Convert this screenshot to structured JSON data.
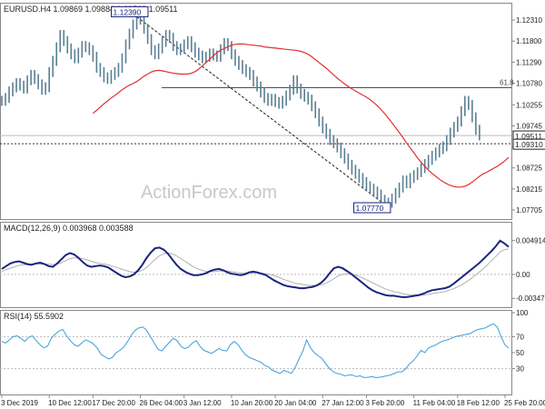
{
  "colors": {
    "price": "#5a7f93",
    "ma": "#e03030",
    "macd": "#1a237e",
    "macd_signal": "#b0b0b0",
    "rsi": "#3b9ddb",
    "level": "#555555",
    "grid_label": "#222222",
    "box_fill": "#ffffff",
    "box_stroke": "#1a237e",
    "box_text": "#1a237e",
    "watermark": "#c8c8c8"
  },
  "watermark": "ActionForex.com",
  "chart_data": [
    {
      "type": "line",
      "title": "EURUSD.H4  1.09869 1.09884 1.09509 1.09511",
      "ylim": [
        1.0755,
        1.1262
      ],
      "yticks": [
        "1.12310",
        "1.11800",
        "1.11290",
        "1.10780",
        "1.10255",
        "1.09745",
        "1.09235",
        "1.08725",
        "1.08215",
        "1.07705"
      ],
      "ytick_values": [
        1.1231,
        1.118,
        1.1129,
        1.1078,
        1.10255,
        1.09745,
        1.09235,
        1.08725,
        1.08215,
        1.07705
      ],
      "x_bars": 140,
      "close": [
        1.1035,
        1.1042,
        1.1058,
        1.1068,
        1.1078,
        1.1072,
        1.1065,
        1.1085,
        1.1098,
        1.1088,
        1.1075,
        1.1062,
        1.1068,
        1.1105,
        1.1132,
        1.1165,
        1.1195,
        1.118,
        1.1162,
        1.1148,
        1.1138,
        1.1152,
        1.1168,
        1.1165,
        1.1158,
        1.1142,
        1.1115,
        1.1105,
        1.1092,
        1.1088,
        1.1098,
        1.1105,
        1.1115,
        1.1138,
        1.1172,
        1.1198,
        1.122,
        1.1238,
        1.1232,
        1.121,
        1.1185,
        1.1158,
        1.1148,
        1.1162,
        1.1178,
        1.1195,
        1.1188,
        1.1168,
        1.1158,
        1.1162,
        1.1172,
        1.118,
        1.1165,
        1.1152,
        1.1145,
        1.1138,
        1.1142,
        1.115,
        1.1145,
        1.1142,
        1.116,
        1.1175,
        1.1168,
        1.1148,
        1.1132,
        1.1122,
        1.1112,
        1.1105,
        1.1098,
        1.1082,
        1.107,
        1.1055,
        1.1042,
        1.1035,
        1.104,
        1.1032,
        1.1028,
        1.1035,
        1.1048,
        1.1062,
        1.1085,
        1.1065,
        1.1052,
        1.1045,
        1.1038,
        1.1022,
        1.1005,
        1.0985,
        1.0968,
        1.0955,
        1.094,
        1.0932,
        1.0922,
        1.0908,
        1.0895,
        1.088,
        1.0868,
        1.0858,
        1.0848,
        1.0838,
        1.0828,
        1.0822,
        1.0815,
        1.0808,
        1.0795,
        1.0782,
        1.0788,
        1.0798,
        1.0812,
        1.0825,
        1.0842,
        1.0835,
        1.0848,
        1.0855,
        1.0862,
        1.0872,
        1.0882,
        1.0892,
        1.0902,
        1.091,
        1.0918,
        1.0925,
        1.094,
        1.0958,
        1.0972,
        1.0985,
        1.101,
        1.1035,
        1.1025,
        1.0995,
        1.0965,
        1.0951
      ],
      "ma": [
        1.1005,
        1.1012,
        1.102,
        1.1028,
        1.1035,
        1.1042,
        1.1048,
        1.1055,
        1.1062,
        1.1068,
        1.1073,
        1.1077,
        1.1082,
        1.1088,
        1.1095,
        1.11,
        1.1105,
        1.1108,
        1.1109,
        1.1108,
        1.1106,
        1.1104,
        1.1102,
        1.1101,
        1.11,
        1.11,
        1.11,
        1.1102,
        1.1106,
        1.1112,
        1.112,
        1.1128,
        1.1136,
        1.1144,
        1.1152,
        1.1158,
        1.1162,
        1.1166,
        1.117,
        1.1172,
        1.1173,
        1.1173,
        1.1172,
        1.1171,
        1.117,
        1.1169,
        1.1168,
        1.1166,
        1.1165,
        1.1164,
        1.1163,
        1.1162,
        1.1161,
        1.116,
        1.1159,
        1.1158,
        1.1157,
        1.1155,
        1.1152,
        1.1148,
        1.1142,
        1.1135,
        1.1128,
        1.1121,
        1.1114,
        1.1106,
        1.1098,
        1.109,
        1.1083,
        1.1076,
        1.107,
        1.1064,
        1.1059,
        1.1054,
        1.1049,
        1.1044,
        1.1038,
        1.1031,
        1.1023,
        1.1014,
        1.1004,
        1.0993,
        1.0982,
        1.097,
        1.0958,
        1.0946,
        1.0933,
        1.0921,
        1.0909,
        1.0897,
        1.0886,
        1.0876,
        1.0867,
        1.0859,
        1.0852,
        1.0845,
        1.0839,
        1.0834,
        1.083,
        1.0827,
        1.0826,
        1.0826,
        1.0828,
        1.0832,
        1.0838,
        1.0845,
        1.0852,
        1.0858,
        1.0862,
        1.0867,
        1.0872,
        1.0877,
        1.0883,
        1.089,
        1.0898
      ],
      "annotations": {
        "top_label": "1.12390",
        "bottom_label": "1.07770",
        "fib_label": "61.8",
        "current_price": "1.09511",
        "level_price": "1.09310",
        "fib_level": 1.1067,
        "level_value": 1.0931,
        "top_value": 1.1239,
        "bottom_value": 1.0777,
        "top_index": 37,
        "bottom_index": 106
      }
    },
    {
      "type": "line",
      "title": "MACD(12,26,9) 0.003968 0.003588",
      "ylim": [
        -0.0045,
        0.0058
      ],
      "yticks": [
        "0.004914",
        "0.00",
        "-0.003476"
      ],
      "ytick_values": [
        0.004914,
        0.0,
        -0.003476
      ],
      "series": [
        {
          "values": [
            0.0008,
            0.0012,
            0.0016,
            0.0018,
            0.0019,
            0.0017,
            0.0015,
            0.0014,
            0.0016,
            0.0017,
            0.0015,
            0.0012,
            0.0011,
            0.0016,
            0.0022,
            0.0028,
            0.0031,
            0.0029,
            0.0024,
            0.0018,
            0.0013,
            0.0011,
            0.0012,
            0.0013,
            0.0012,
            0.001,
            0.0006,
            0.0002,
            -0.0002,
            -0.0004,
            -0.0003,
            0.0,
            0.0006,
            0.0014,
            0.0024,
            0.0032,
            0.0038,
            0.0039,
            0.0036,
            0.003,
            0.0022,
            0.0014,
            0.0008,
            0.0004,
            0.0001,
            -0.0001,
            -0.0001,
            0.0,
            0.0002,
            0.0005,
            0.0007,
            0.0008,
            0.0006,
            0.0003,
            0.0001,
            0.0,
            -0.0001,
            0.0,
            0.0003,
            0.0004,
            0.0003,
            0.0001,
            -0.0001,
            -0.0005,
            -0.0009,
            -0.0012,
            -0.0015,
            -0.0017,
            -0.0018,
            -0.0019,
            -0.002,
            -0.002,
            -0.0019,
            -0.0018,
            -0.0016,
            -0.0012,
            -0.0006,
            0.0002,
            0.0009,
            0.0011,
            0.0009,
            0.0005,
            0.0001,
            -0.0004,
            -0.0009,
            -0.0014,
            -0.0019,
            -0.0023,
            -0.0026,
            -0.0028,
            -0.003,
            -0.0031,
            -0.0031,
            -0.0032,
            -0.0033,
            -0.0033,
            -0.0032,
            -0.0031,
            -0.003,
            -0.0028,
            -0.0025,
            -0.0023,
            -0.0022,
            -0.0021,
            -0.002,
            -0.0018,
            -0.0014,
            -0.0009,
            -0.0004,
            0.0001,
            0.0006,
            0.0011,
            0.0016,
            0.0022,
            0.0028,
            0.0034,
            0.0041,
            0.0049,
            0.0045,
            0.004
          ]
        },
        {
          "values": [
            0.0004,
            0.0007,
            0.0009,
            0.0011,
            0.0013,
            0.0014,
            0.0014,
            0.0014,
            0.0015,
            0.0015,
            0.0015,
            0.0015,
            0.0014,
            0.0015,
            0.0017,
            0.002,
            0.0023,
            0.0024,
            0.0024,
            0.0023,
            0.0021,
            0.0019,
            0.0017,
            0.0016,
            0.0015,
            0.0014,
            0.0012,
            0.001,
            0.0008,
            0.0006,
            0.0004,
            0.0003,
            0.0004,
            0.0006,
            0.001,
            0.0016,
            0.0022,
            0.0027,
            0.003,
            0.0031,
            0.003,
            0.0027,
            0.0023,
            0.0019,
            0.0015,
            0.0011,
            0.0008,
            0.0006,
            0.0004,
            0.0004,
            0.0004,
            0.0005,
            0.0005,
            0.0005,
            0.0004,
            0.0003,
            0.0002,
            0.0002,
            0.0002,
            0.0002,
            0.0002,
            0.0002,
            0.0001,
            0.0,
            -0.0002,
            -0.0004,
            -0.0007,
            -0.0009,
            -0.0011,
            -0.0013,
            -0.0014,
            -0.0015,
            -0.0016,
            -0.0016,
            -0.0016,
            -0.0015,
            -0.0013,
            -0.001,
            -0.0006,
            -0.0002,
            0.0,
            0.0001,
            0.0,
            -0.0001,
            -0.0003,
            -0.0006,
            -0.0009,
            -0.0012,
            -0.0015,
            -0.0018,
            -0.0021,
            -0.0023,
            -0.0025,
            -0.0026,
            -0.0028,
            -0.0029,
            -0.003,
            -0.003,
            -0.003,
            -0.003,
            -0.0029,
            -0.0028,
            -0.0027,
            -0.0026,
            -0.0025,
            -0.0023,
            -0.0021,
            -0.0018,
            -0.0015,
            -0.0011,
            -0.0007,
            -0.0002,
            0.0003,
            0.0008,
            0.0014,
            0.002,
            0.0026,
            0.0033,
            0.0036,
            0.0037
          ]
        }
      ]
    },
    {
      "type": "line",
      "title": "RSI(14) 55.5902",
      "ylim": [
        0,
        100
      ],
      "yticks": [
        "100",
        "70",
        "50",
        "30"
      ],
      "ytick_values": [
        100,
        70,
        50,
        30
      ],
      "series": [
        {
          "values": [
            64,
            62,
            66,
            70,
            71,
            68,
            64,
            69,
            71,
            65,
            60,
            56,
            58,
            68,
            73,
            77,
            79,
            71,
            65,
            60,
            58,
            62,
            66,
            64,
            61,
            56,
            48,
            45,
            42,
            44,
            50,
            53,
            57,
            64,
            72,
            78,
            81,
            82,
            78,
            70,
            62,
            54,
            52,
            58,
            63,
            68,
            65,
            58,
            55,
            57,
            62,
            65,
            58,
            53,
            51,
            49,
            52,
            55,
            53,
            52,
            60,
            64,
            60,
            53,
            47,
            44,
            42,
            40,
            38,
            34,
            32,
            28,
            26,
            24,
            28,
            26,
            24,
            32,
            42,
            52,
            66,
            56,
            50,
            46,
            43,
            36,
            30,
            26,
            24,
            23,
            21,
            22,
            22,
            20,
            21,
            19,
            19,
            20,
            19,
            19,
            20,
            21,
            22,
            24,
            26,
            26,
            30,
            36,
            40,
            46,
            53,
            50,
            56,
            58,
            60,
            63,
            65,
            66,
            68,
            70,
            71,
            72,
            73,
            74,
            77,
            79,
            80,
            81,
            84,
            86,
            82,
            70,
            60,
            55.6
          ]
        }
      ]
    }
  ],
  "x_axis": {
    "labels": [
      "3 Dec 2019",
      "10 Dec 12:00",
      "17 Dec 20:00",
      "26 Dec 04:00",
      "3 Jan 12:00",
      "10 Jan 20:00",
      "20 Jan 04:00",
      "27 Jan 12:00",
      "3 Feb 20:00",
      "11 Feb 04:00",
      "18 Feb 12:00",
      "25 Feb 20:00"
    ],
    "label_index": [
      0,
      13,
      25,
      38,
      50,
      63,
      75,
      88,
      100,
      113,
      125,
      138
    ]
  }
}
